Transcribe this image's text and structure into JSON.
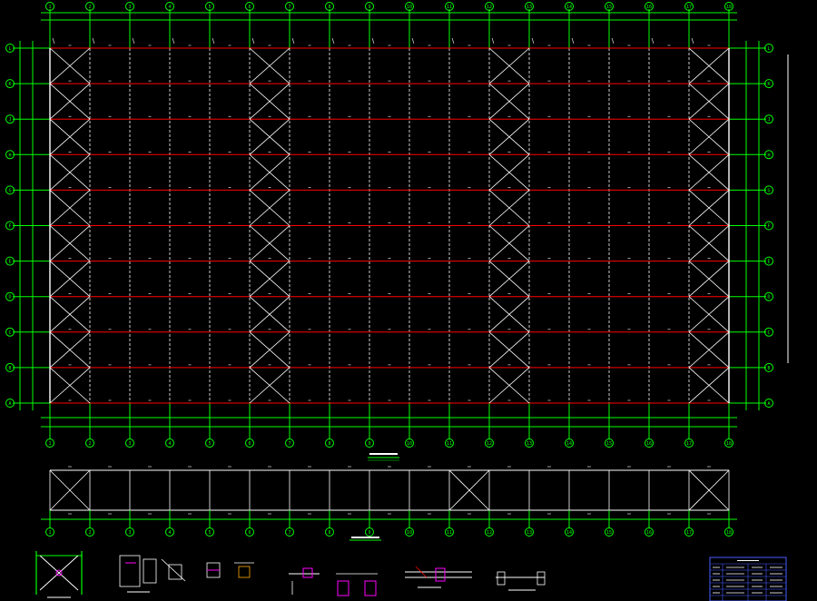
{
  "colors": {
    "background": "#000000",
    "grid_line": "#00ff00",
    "purlin": "#ff0000",
    "frame_member": "#ffffff",
    "bracing": "#ffffff",
    "detail_accent": "#ff00ff",
    "table_border": "#4a5cff",
    "annotation": "#ffffff",
    "grid_bubble": "#00ff00"
  },
  "plan": {
    "column_axes": [
      "1",
      "2",
      "3",
      "4",
      "5",
      "6",
      "7",
      "8",
      "9",
      "10",
      "11",
      "12",
      "13",
      "14",
      "15",
      "16",
      "17",
      "18"
    ],
    "row_axes": [
      "A",
      "B",
      "C",
      "D",
      "E",
      "F",
      "G",
      "H",
      "J",
      "K",
      "L"
    ],
    "bracing_bays": [
      1,
      6,
      12,
      18
    ]
  },
  "elevation": {
    "column_axes": [
      "1",
      "2",
      "3",
      "4",
      "5",
      "6",
      "7",
      "8",
      "9",
      "10",
      "11",
      "12",
      "13",
      "14",
      "15",
      "16",
      "17",
      "18"
    ],
    "bracing_bays": [
      1,
      11,
      17
    ]
  },
  "details": {
    "items": [
      "bracing-node-detail",
      "purlin-connection-detail",
      "column-base-detail",
      "end-plate-detail",
      "cap-detail",
      "beam-splice-detail",
      "gutter-detail",
      "eave-detail",
      "material-table"
    ]
  }
}
